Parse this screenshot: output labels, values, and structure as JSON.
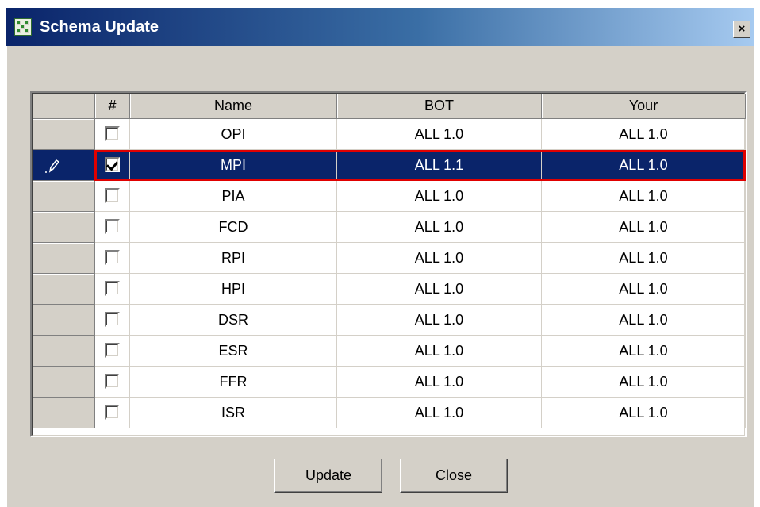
{
  "window": {
    "title": "Schema Update",
    "close_glyph": "×"
  },
  "icons": {
    "app": "schema-app-icon",
    "close": "close-icon",
    "row_edit": "pencil-icon"
  },
  "colors": {
    "selection": "#0a246a",
    "highlight_outline": "#e00000",
    "titlebar_start": "#0a246a",
    "titlebar_end": "#a6caf0"
  },
  "grid": {
    "columns": [
      "#",
      "Name",
      "BOT",
      "Your"
    ],
    "rows": [
      {
        "checked": false,
        "name": "OPI",
        "bot": "ALL 1.0",
        "your": "ALL 1.0",
        "selected": false
      },
      {
        "checked": true,
        "name": "MPI",
        "bot": "ALL 1.1",
        "your": "ALL 1.0",
        "selected": true
      },
      {
        "checked": false,
        "name": "PIA",
        "bot": "ALL 1.0",
        "your": "ALL 1.0",
        "selected": false
      },
      {
        "checked": false,
        "name": "FCD",
        "bot": "ALL 1.0",
        "your": "ALL 1.0",
        "selected": false
      },
      {
        "checked": false,
        "name": "RPI",
        "bot": "ALL 1.0",
        "your": "ALL 1.0",
        "selected": false
      },
      {
        "checked": false,
        "name": "HPI",
        "bot": "ALL 1.0",
        "your": "ALL 1.0",
        "selected": false
      },
      {
        "checked": false,
        "name": "DSR",
        "bot": "ALL 1.0",
        "your": "ALL 1.0",
        "selected": false
      },
      {
        "checked": false,
        "name": "ESR",
        "bot": "ALL 1.0",
        "your": "ALL 1.0",
        "selected": false
      },
      {
        "checked": false,
        "name": "FFR",
        "bot": "ALL 1.0",
        "your": "ALL 1.0",
        "selected": false
      },
      {
        "checked": false,
        "name": "ISR",
        "bot": "ALL 1.0",
        "your": "ALL 1.0",
        "selected": false
      }
    ]
  },
  "buttons": {
    "update": "Update",
    "close": "Close"
  }
}
